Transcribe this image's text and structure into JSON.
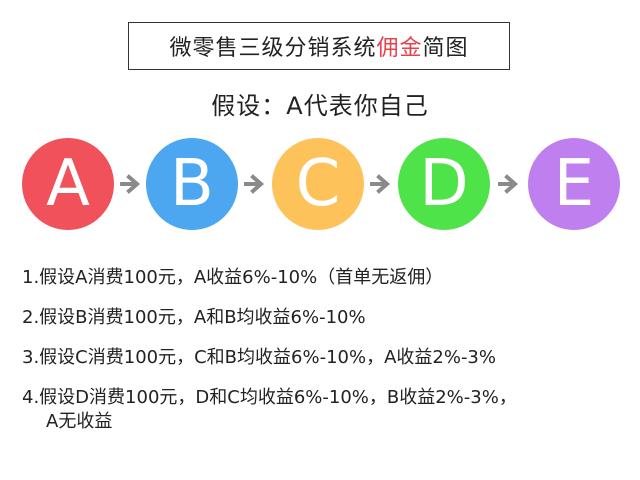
{
  "title": {
    "before": "微零售三级分销系统",
    "highlight": "佣金",
    "after": "简图"
  },
  "assumption": "假设：A代表你自己",
  "nodes": [
    {
      "letter": "A",
      "color": "#f0515a"
    },
    {
      "letter": "B",
      "color": "#4da6f0"
    },
    {
      "letter": "C",
      "color": "#fdc35a"
    },
    {
      "letter": "D",
      "color": "#4fe34a"
    },
    {
      "letter": "E",
      "color": "#bf7fee"
    }
  ],
  "arrow_icon": "arrow-right-icon",
  "arrow_color": "#8a8a8a",
  "rules": [
    {
      "text": "1.假设A消费100元，A收益6%-10%（首单无返佣）"
    },
    {
      "text": "2.假设B消费100元，A和B均收益6%-10%"
    },
    {
      "text": "3.假设C消费100元，C和B均收益6%-10%，A收益2%-3%"
    },
    {
      "text": "4.假设D消费100元，D和C均收益6%-10%，B收益2%-3%，",
      "continuation": "A无收益"
    }
  ]
}
